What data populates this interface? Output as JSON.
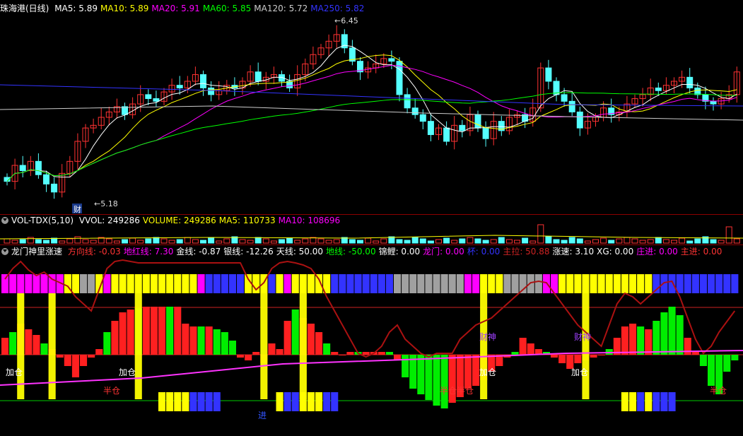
{
  "panel1": {
    "name": "珠海港(日线)",
    "items": [
      {
        "label": "MA5: ",
        "value": "5.89",
        "color": "#ffffff"
      },
      {
        "label": "MA10: ",
        "value": "5.89",
        "color": "#ffff00"
      },
      {
        "label": "MA20: ",
        "value": "5.91",
        "color": "#ff00ff"
      },
      {
        "label": "MA60: ",
        "value": "5.85",
        "color": "#00ff00"
      },
      {
        "label": "MA120: ",
        "value": "5.72",
        "color": "#cccccc"
      },
      {
        "label": "MA250: ",
        "value": "5.82",
        "color": "#3333ff"
      }
    ],
    "high_label": "6.45",
    "low_label": "5.18",
    "cai_badge": "财"
  },
  "panel2": {
    "name": "VOL-TDX(5,10)",
    "items": [
      {
        "label": "VVOL: ",
        "value": "249286",
        "color": "#ffffff"
      },
      {
        "label": "VOLUME: ",
        "value": "249286",
        "color": "#ffff00"
      },
      {
        "label": "MA5: ",
        "value": "110733",
        "color": "#ffff00"
      },
      {
        "label": "MA10: ",
        "value": "108696",
        "color": "#ff00ff"
      }
    ]
  },
  "panel3": {
    "name": "龙门神里涨速",
    "items": [
      {
        "label": "方向线: ",
        "value": "-0.03",
        "color": "#ff3333"
      },
      {
        "label": "地红线: ",
        "value": "7.30",
        "color": "#ff00ff"
      },
      {
        "label": "金线: ",
        "value": "-0.87",
        "color": "#ffffff"
      },
      {
        "label": "银线: ",
        "value": "-12.26",
        "color": "#ffffff"
      },
      {
        "label": "天线: ",
        "value": "50.00",
        "color": "#ffffff"
      },
      {
        "label": "地线: ",
        "value": "-50.00",
        "color": "#00ff00"
      },
      {
        "label": "锦鲤: ",
        "value": "0.00",
        "color": "#ffffff"
      },
      {
        "label": "龙门: ",
        "value": "0.00",
        "color": "#ff00ff"
      },
      {
        "label": "杯: ",
        "value": "0.00",
        "color": "#3333ff"
      },
      {
        "label": "主拉: ",
        "value": "50.88",
        "color": "#cc2222"
      },
      {
        "label": "涨速: ",
        "value": "3.10",
        "color": "#ffffff"
      },
      {
        "label": "XG: ",
        "value": "0.00",
        "color": "#ffffff"
      },
      {
        "label": "庄进: ",
        "value": "0.00",
        "color": "#ff00ff"
      },
      {
        "label": "主进: ",
        "value": "0.00",
        "color": "#ff3333"
      }
    ],
    "annotations": [
      "加仓",
      "加仓",
      "半仓",
      "进",
      "半仓半仓",
      "加仓",
      "加仓",
      "半仓",
      "财神",
      "财神"
    ]
  },
  "colors": {
    "up": "#ff3232",
    "down": "#54ffff",
    "bg": "#000000",
    "sep": "#8b0000"
  },
  "chart_data": {
    "type": "candlestick",
    "series": [
      {
        "name": "MA5",
        "color": "#ffffff",
        "last": 5.89
      },
      {
        "name": "MA10",
        "color": "#ffff00",
        "last": 5.89
      },
      {
        "name": "MA20",
        "color": "#ff00ff",
        "last": 5.91
      },
      {
        "name": "MA60",
        "color": "#00ff00",
        "last": 5.85
      },
      {
        "name": "MA120",
        "color": "#cccccc",
        "last": 5.72
      },
      {
        "name": "MA250",
        "color": "#3333ff",
        "last": 5.82
      }
    ],
    "highest": 6.45,
    "lowest": 5.18,
    "volume": {
      "vvol": 249286,
      "volume": 249286,
      "ma5": 110733,
      "ma10": 108696
    }
  }
}
